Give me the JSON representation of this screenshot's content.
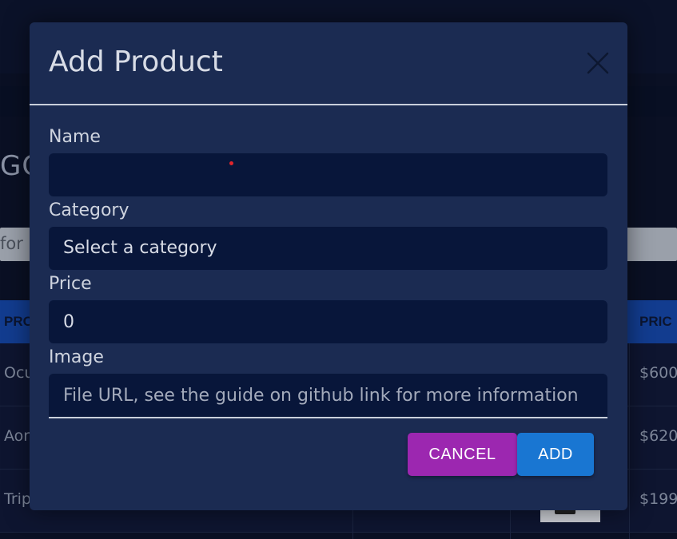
{
  "background": {
    "heading": "GC",
    "search_placeholder": "for p",
    "table_headers": [
      "PRO",
      "PRIC"
    ],
    "rows": [
      {
        "name": "Ocu",
        "price": "$600"
      },
      {
        "name": "Aor",
        "price": "$620"
      },
      {
        "name": "Trip",
        "price": "$199"
      }
    ]
  },
  "modal": {
    "title": "Add Product",
    "close_icon": "close-x-icon",
    "fields": {
      "name": {
        "label": "Name",
        "value": ""
      },
      "category": {
        "label": "Category",
        "value": "Select a category"
      },
      "price": {
        "label": "Price",
        "value": "0"
      },
      "image": {
        "label": "Image",
        "placeholder": "File URL, see the guide on github link for more information"
      }
    },
    "buttons": {
      "cancel": "CANCEL",
      "add": "ADD"
    }
  },
  "colors": {
    "modal_bg": "#1b2b52",
    "field_bg": "#08163a",
    "cancel": "#9c27b0",
    "add": "#1976d2"
  }
}
